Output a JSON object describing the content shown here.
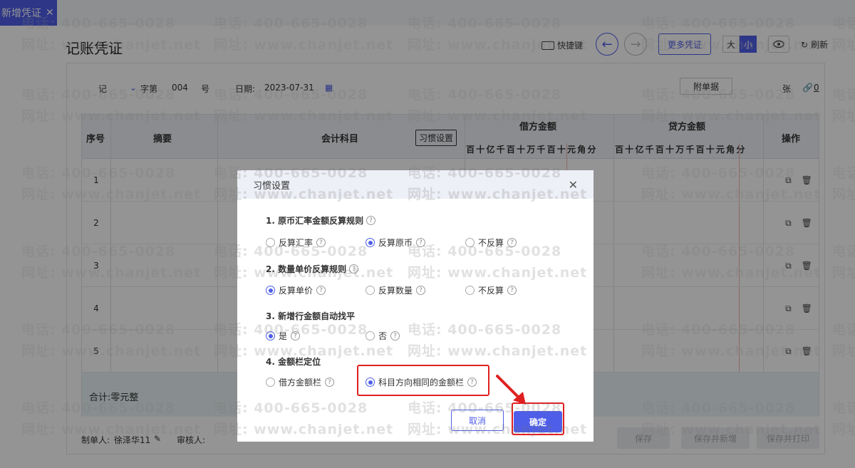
{
  "tab": {
    "label": "新增凭证"
  },
  "header": {
    "title": "记账凭证",
    "shortcut_label": "快捷键",
    "more_label": "更多凭证",
    "size_large": "大",
    "size_small": "小",
    "refresh_label": "刷新"
  },
  "voucher": {
    "word": "记",
    "word_suffix": "字第",
    "number": "004",
    "number_suffix": "号",
    "date_label": "日期:",
    "date_value": "2023-07-31",
    "attach_label": "附单据",
    "attach_unit": "张",
    "attach_count": "0"
  },
  "table": {
    "col_no": "序号",
    "col_summary": "摘要",
    "col_account": "会计科目",
    "habit_button": "习惯设置",
    "col_debit": "借方金额",
    "col_credit": "贷方金额",
    "col_ops": "操作",
    "digits": [
      "百",
      "十",
      "亿",
      "千",
      "百",
      "十",
      "万",
      "千",
      "百",
      "十",
      "元",
      "角",
      "分"
    ],
    "rows": [
      "1",
      "2",
      "3",
      "4",
      "5"
    ],
    "total_label": "合计:零元整"
  },
  "footer": {
    "maker_label": "制单人:",
    "maker_name": "徐泽华11",
    "reviewer_label": "审核人:",
    "save_label": "保存",
    "save_new_label": "保存并新增",
    "save_print_label": "保存并打印"
  },
  "dialog": {
    "title": "习惯设置",
    "close": "✕",
    "s1": "1. 原币汇率金额反算规则",
    "s1_opt1": "反算汇率",
    "s1_opt2": "反算原币",
    "s1_opt3": "不反算",
    "s2": "2. 数量单价反算规则",
    "s2_opt1": "反算单价",
    "s2_opt2": "反算数量",
    "s2_opt3": "不反算",
    "s3": "3. 新增行金额自动找平",
    "s3_opt1": "是",
    "s3_opt2": "否",
    "s4": "4. 金额栏定位",
    "s4_opt1": "借方金额栏",
    "s4_opt2": "科目方向相同的金额栏",
    "cancel": "取消",
    "ok": "确定",
    "help": "?"
  },
  "watermark": {
    "phone": "电话: 400-665-0028",
    "site": "网址: www.chanjet.net"
  },
  "colors": {
    "accent": "#4e5ee8",
    "highlight": "#e02020"
  }
}
